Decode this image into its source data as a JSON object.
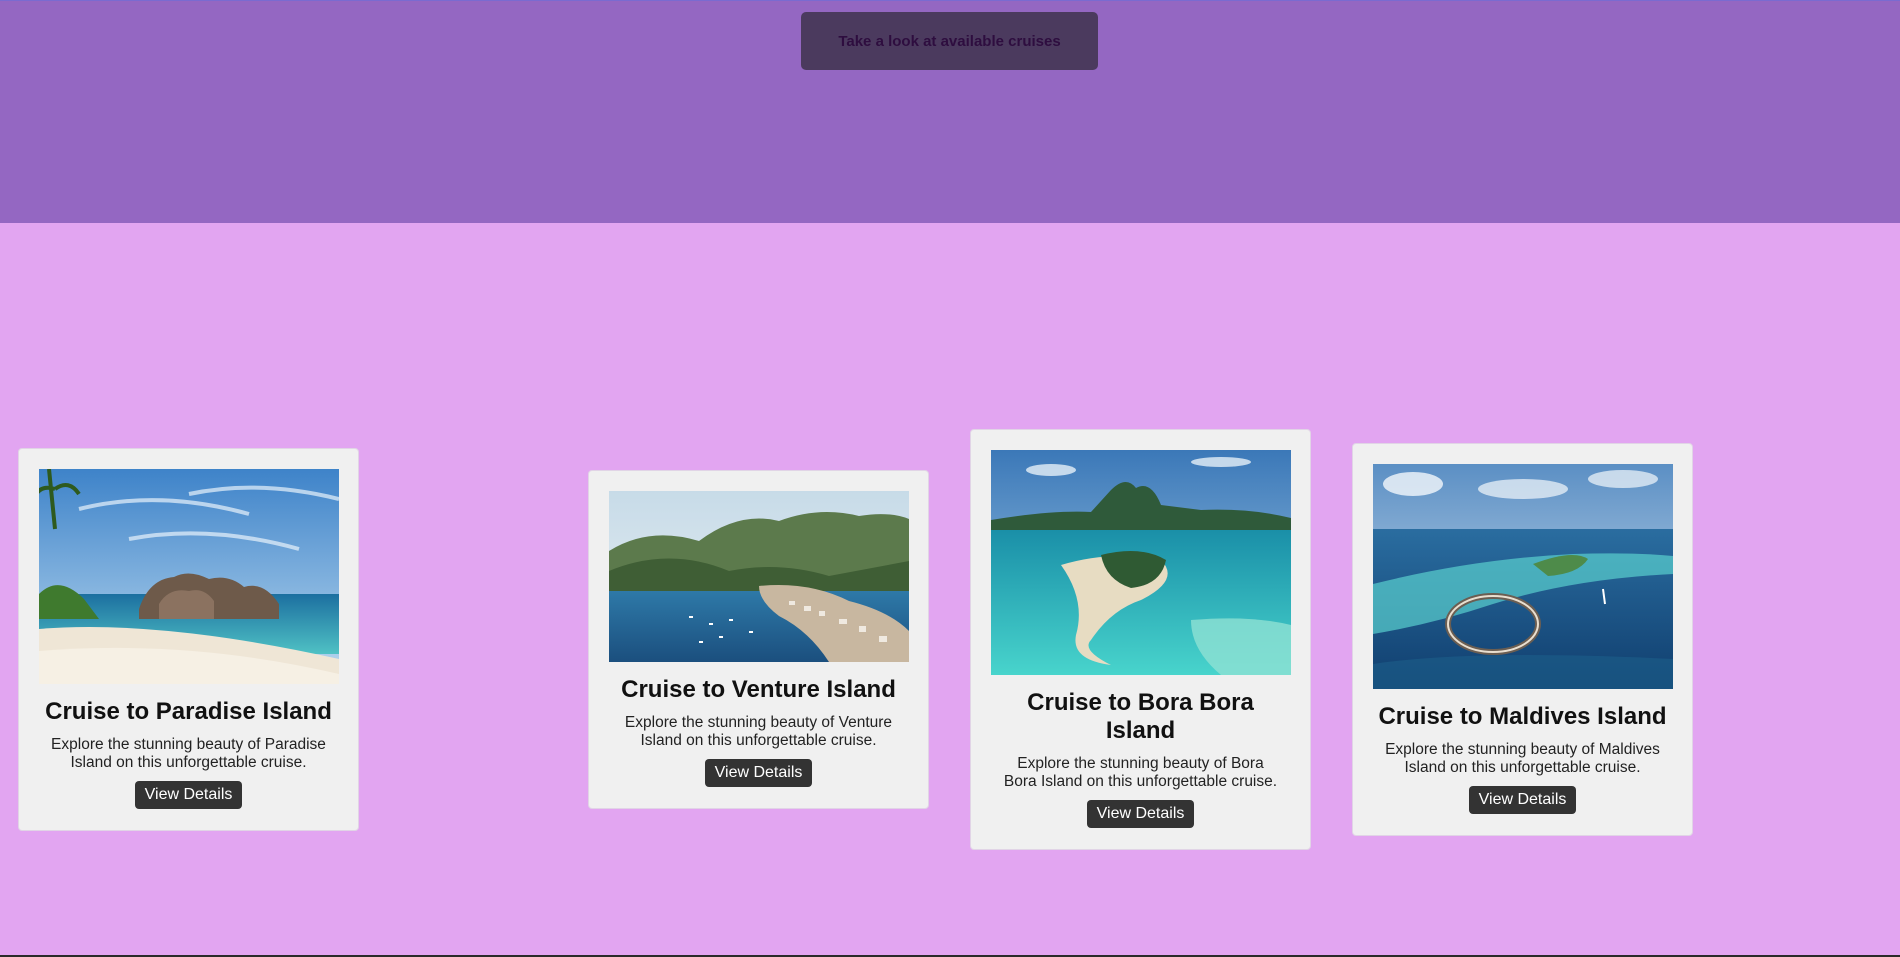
{
  "header": {
    "cta_label": "Take a look at available cruises",
    "band_color": "#9467c2",
    "page_color": "#e2a5f1"
  },
  "cards": [
    {
      "title": "Cruise to Paradise Island",
      "description": "Explore the stunning beauty of Paradise Island on this unforgettable cruise.",
      "button_label": "View Details",
      "image": "beach-with-granite-rocks-photo"
    },
    {
      "title": "Cruise to Venture Island",
      "description": "Explore the stunning beauty of Venture Island on this unforgettable cruise.",
      "button_label": "View Details",
      "image": "harbor-town-with-mountains-photo"
    },
    {
      "title": "Cruise to Bora Bora Island",
      "description": "Explore the stunning beauty of Bora Bora Island on this unforgettable cruise.",
      "button_label": "View Details",
      "image": "lagoon-island-aerial-photo"
    },
    {
      "title": "Cruise to Maldives Island",
      "description": "Explore the stunning beauty of Maldives Island on this unforgettable cruise.",
      "button_label": "View Details",
      "image": "overwater-villas-aerial-photo"
    }
  ]
}
